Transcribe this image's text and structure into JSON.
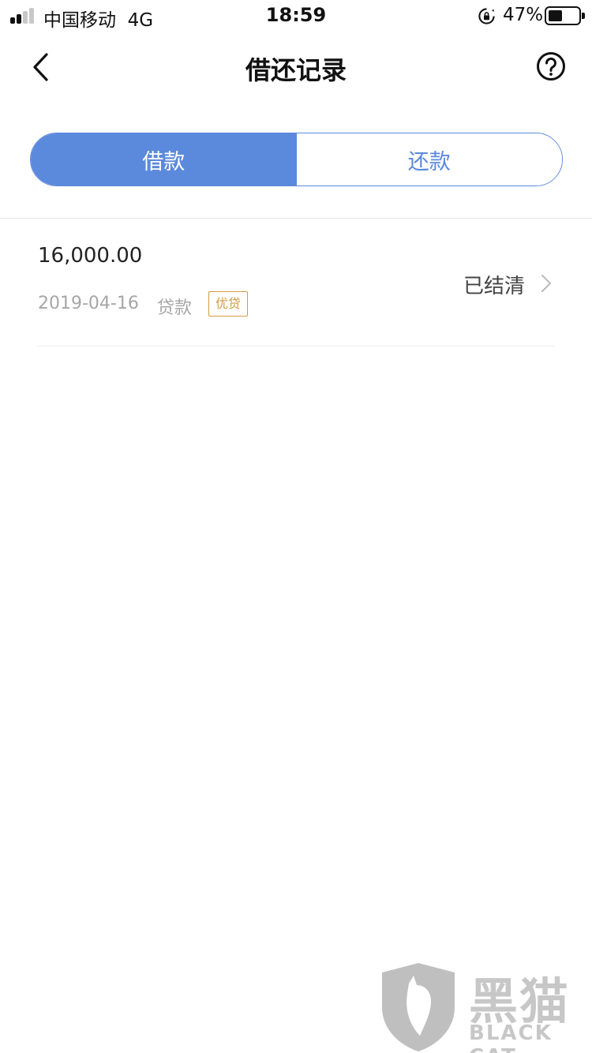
{
  "status_bar": {
    "carrier": "中国移动",
    "network": "4G",
    "time": "18:59",
    "battery": "47%",
    "battery_level": 0.47
  },
  "nav": {
    "title": "借还记录",
    "back_icon": "chevron-left-icon",
    "help_icon": "question-circle-icon"
  },
  "tabs": [
    {
      "label": "借款",
      "active": true
    },
    {
      "label": "还款",
      "active": false
    }
  ],
  "records": [
    {
      "amount": "16,000.00",
      "date": "2019-04-16",
      "type": "贷款",
      "tag": "优贷",
      "status": "已结清"
    }
  ],
  "watermark": {
    "cn": "黑猫",
    "en": "BLACK CAT"
  },
  "colors": {
    "accent": "#5b89dc",
    "tag": "#d39a3f",
    "muted": "#a6a6a6"
  }
}
